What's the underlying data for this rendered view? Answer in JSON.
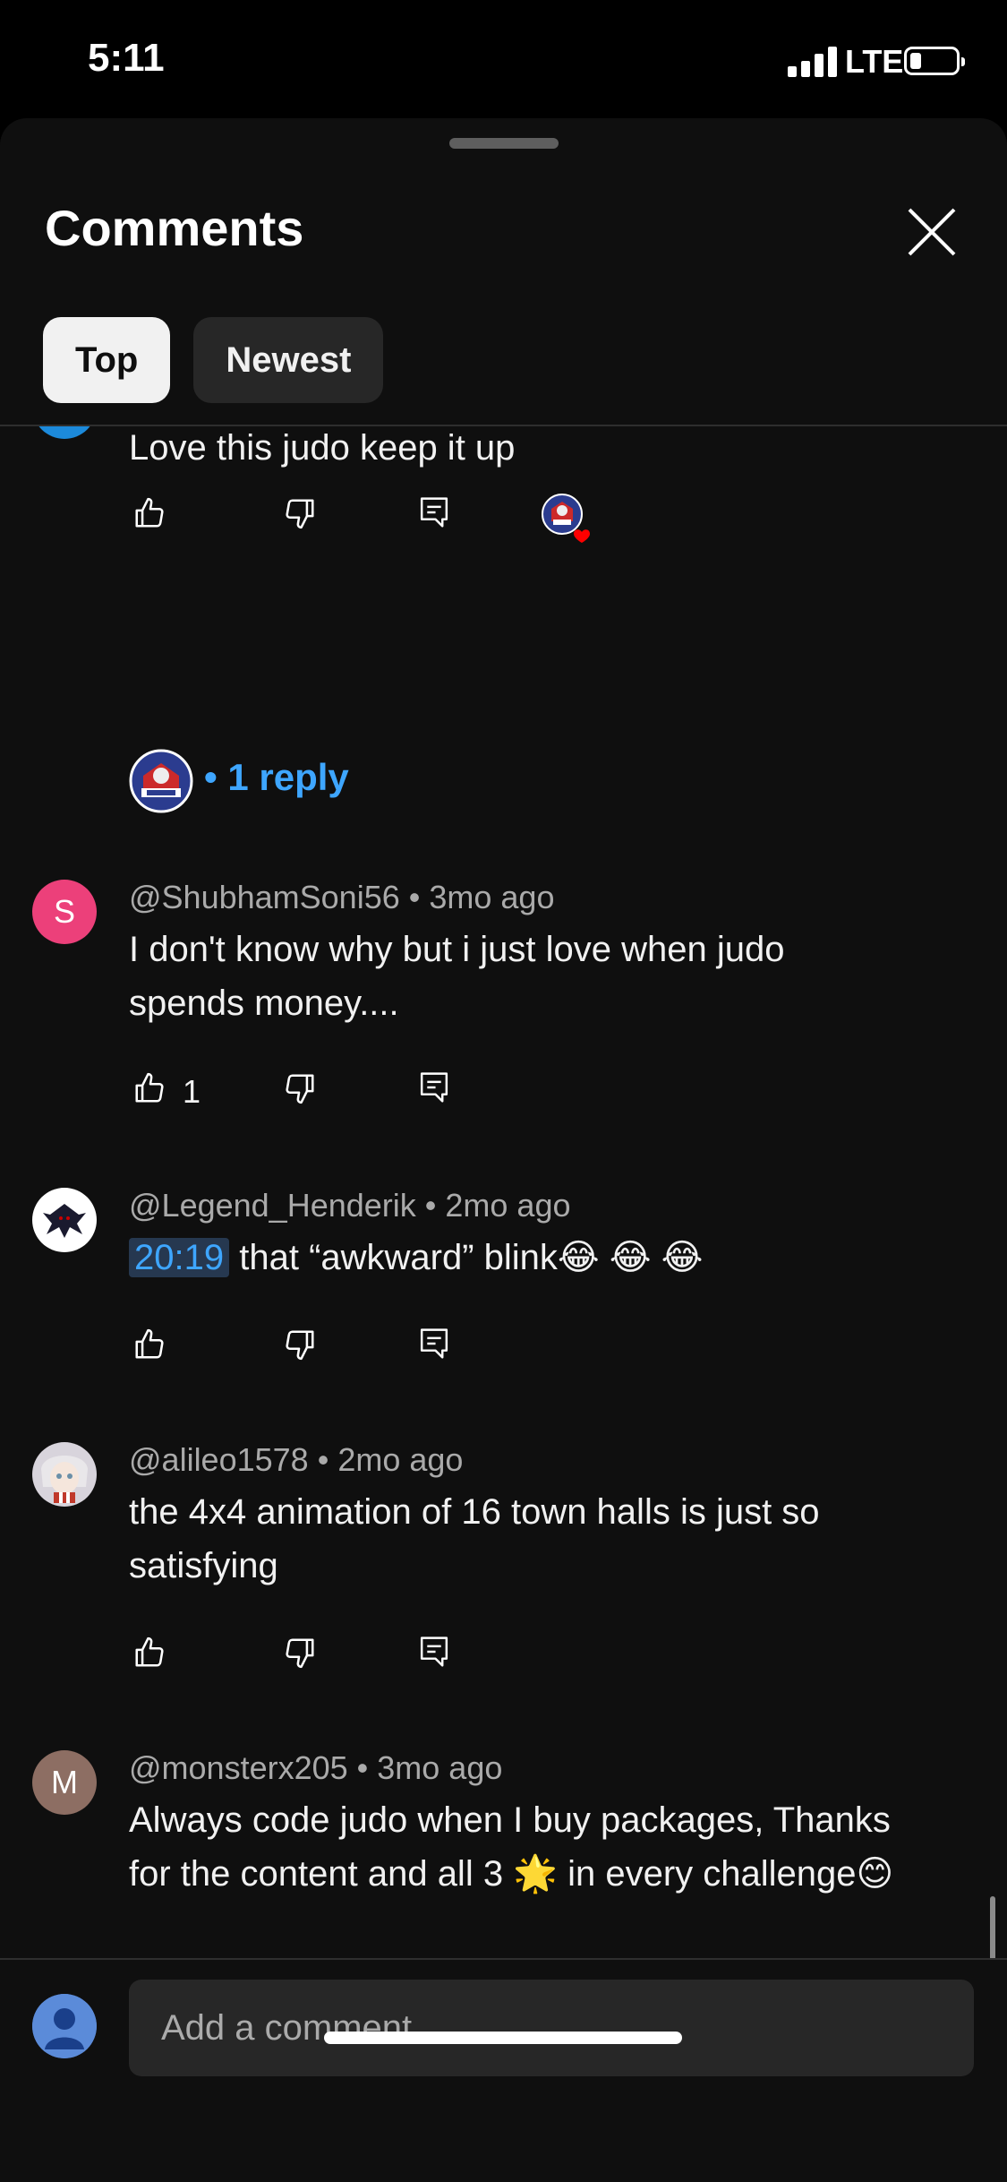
{
  "status": {
    "time": "5:11",
    "network": "LTE"
  },
  "header": {
    "title": "Comments"
  },
  "tabs": [
    {
      "label": "Top"
    },
    {
      "label": "Newest"
    }
  ],
  "comments": [
    {
      "text": "Love this judo keep it up",
      "reply_label": "• 1 reply"
    },
    {
      "author": "@ShubhamSoni56",
      "age": "• 3mo ago",
      "avatar_letter": "S",
      "text": "I don't know why but i just love when judo spends money....",
      "likes": "1"
    },
    {
      "author": "@Legend_Henderik",
      "age": "• 2mo ago",
      "timestamp": "20:19",
      "text": "that “awkward” blink😂 😂 😂"
    },
    {
      "author": "@alileo1578",
      "age": "• 2mo ago",
      "text": "the 4x4 animation of 16 town halls is just so satisfying"
    },
    {
      "author": "@monsterx205",
      "age": "• 3mo ago",
      "avatar_letter": "M",
      "text": "Always code judo when I buy packages, Thanks for the content and all 3 🌟 in every challenge😊"
    }
  ],
  "composer": {
    "placeholder": "Add a comment..."
  },
  "colors": {
    "accent": "#3ea6ff",
    "background": "#0f0f0f",
    "heart": "#ff0000"
  }
}
